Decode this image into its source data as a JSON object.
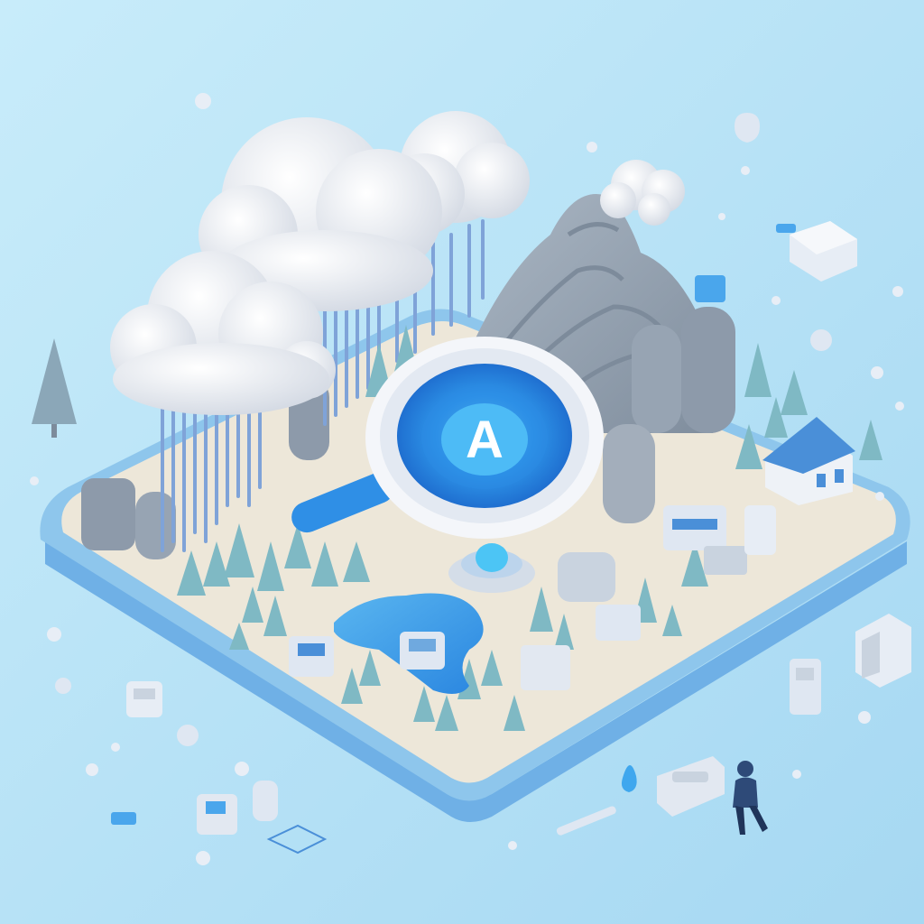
{
  "scene": {
    "description_free": true,
    "lens_letter": "A"
  },
  "palette": {
    "background": "#b7e3f6",
    "background_light": "#c8ecfa",
    "platform_top": "#ede7d9",
    "platform_edge": "#8ec6ec",
    "platform_side": "#6fb0e6",
    "cloud": "#eef0f4",
    "cloud_shade": "#cfd6e0",
    "rain": "#7fa3d8",
    "mountain": "#9aa7b5",
    "mountain_shade": "#7d8b9b",
    "tree": "#7fb9c4",
    "tree_shade": "#5f9fb0",
    "water": "#3f9ee8",
    "lens_ring": "#f4f6fa",
    "lens_inner": "#2f8fe6",
    "lens_core": "#47b8f5",
    "handle": "#2f8fe6",
    "house_roof": "#4a8fd8",
    "house_wall": "#eef2f7",
    "person": "#2e4a78"
  },
  "icons": {
    "magnifier": "magnifier-icon",
    "person": "person-figure",
    "house": "house-icon"
  }
}
